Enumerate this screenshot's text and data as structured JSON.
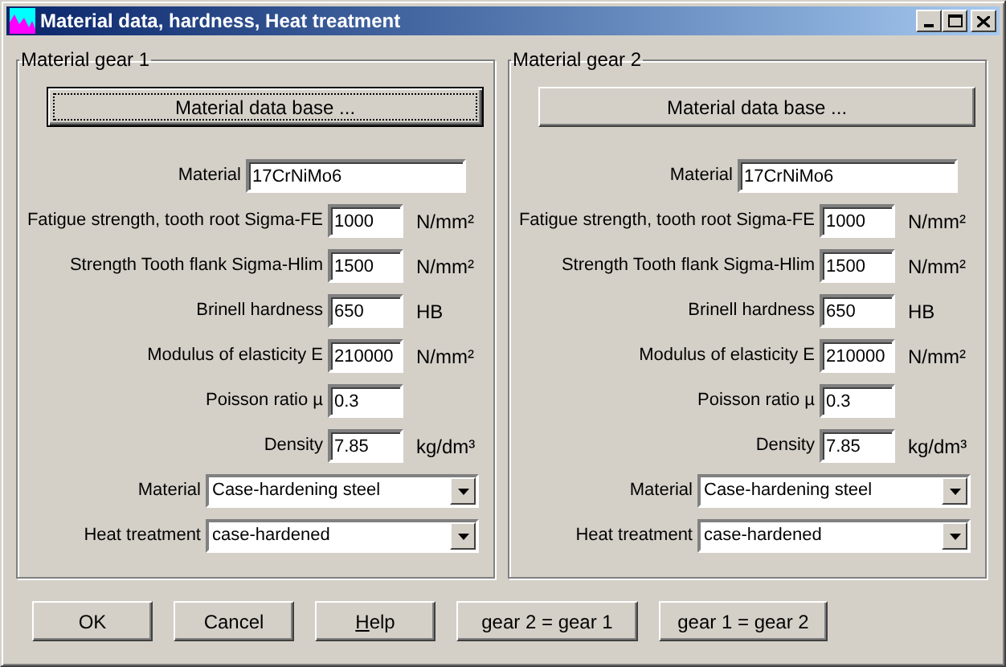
{
  "window": {
    "title": "Material data, hardness, Heat treatment"
  },
  "gears": [
    {
      "title": "Material gear 1",
      "database_button": {
        "label": "Material data base ...",
        "focused": true
      },
      "rows": [
        {
          "kind": "text",
          "label": "Material",
          "value": "17CrNiMo6"
        },
        {
          "kind": "number",
          "label": "Fatigue strength, tooth root Sigma-FE",
          "value": "1000",
          "unit": "N/mm²"
        },
        {
          "kind": "number",
          "label": "Strength Tooth flank Sigma-Hlim",
          "value": "1500",
          "unit": "N/mm²"
        },
        {
          "kind": "number",
          "label": "Brinell hardness",
          "value": "650",
          "unit": "HB"
        },
        {
          "kind": "number",
          "label": "Modulus of elasticity E",
          "value": "210000",
          "unit": "N/mm²"
        },
        {
          "kind": "number",
          "label": "Poisson ratio µ",
          "value": "0.3"
        },
        {
          "kind": "number",
          "label": "Density",
          "value": "7.85",
          "unit": "kg/dm³"
        },
        {
          "kind": "select",
          "label": "Material",
          "value": "Case-hardening steel"
        },
        {
          "kind": "select",
          "label": "Heat treatment",
          "value": "case-hardened"
        }
      ]
    },
    {
      "title": "Material gear 2",
      "database_button": {
        "label": "Material data base ...",
        "focused": false
      },
      "rows": [
        {
          "kind": "text",
          "label": "Material",
          "value": "17CrNiMo6"
        },
        {
          "kind": "number",
          "label": "Fatigue strength, tooth root Sigma-FE",
          "value": "1000",
          "unit": "N/mm²"
        },
        {
          "kind": "number",
          "label": "Strength Tooth flank Sigma-Hlim",
          "value": "1500",
          "unit": "N/mm²"
        },
        {
          "kind": "number",
          "label": "Brinell hardness",
          "value": "650",
          "unit": "HB"
        },
        {
          "kind": "number",
          "label": "Modulus of elasticity E",
          "value": "210000",
          "unit": "N/mm²"
        },
        {
          "kind": "number",
          "label": "Poisson ratio µ",
          "value": "0.3"
        },
        {
          "kind": "number",
          "label": "Density",
          "value": "7.85",
          "unit": "kg/dm³"
        },
        {
          "kind": "select",
          "label": "Material",
          "value": "Case-hardening steel"
        },
        {
          "kind": "select",
          "label": "Heat treatment",
          "value": "case-hardened"
        }
      ]
    }
  ],
  "buttons": [
    {
      "label": "OK",
      "first_letter_underlined": false
    },
    {
      "label": "Cancel",
      "first_letter_underlined": false
    },
    {
      "label": "Help",
      "first_letter_underlined": true
    },
    {
      "label": "gear 2 = gear 1",
      "first_letter_underlined": false
    },
    {
      "label": "gear 1 = gear 2",
      "first_letter_underlined": false
    }
  ]
}
